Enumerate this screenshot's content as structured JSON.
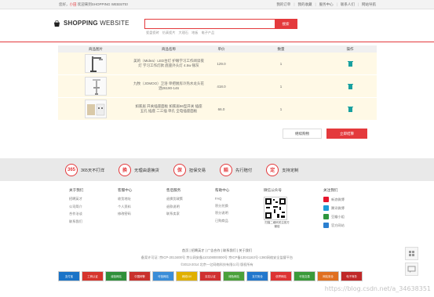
{
  "topbar": {
    "greeting": "您好，",
    "user": "小田",
    "welcome": "欢迎来到SHOPPING WEBSITE!",
    "links": [
      "我的订单",
      "我的收藏",
      "服务中心",
      "联系人们",
      "网站导航"
    ]
  },
  "logo": {
    "bold": "SHOPPING",
    "rest": " WEBSITE"
  },
  "search": {
    "placeholder": "",
    "button": "搜索",
    "hotwords": [
      "瓷盘瓷砖",
      "仿真瓷片",
      "大理石",
      "地板",
      "电子产品"
    ]
  },
  "cart": {
    "headers": [
      "商品图片",
      "商品名称",
      "单价",
      "数量",
      "操作"
    ],
    "rows": [
      {
        "name": "美的（Midea）LED台灯 护眼学习工作阅读夜灯 学习工作灯款 底座外头灯 4.5w 银灰",
        "price": "129.0",
        "qty": "1"
      },
      {
        "name": "九牧（JOMOO）卫浴 单把厨房冷热水龙头花洒26190-146",
        "price": "418.0",
        "qty": "1"
      },
      {
        "name": "如家居 开关插座面板 如家居86型开关 插座 五孔 插座 二三插 单孔 全电插座面板",
        "price": "66.0",
        "qty": "1"
      }
    ],
    "continue_button": "继续购物",
    "checkout_button": "立即结算"
  },
  "services": [
    {
      "icon": "365",
      "label": "365天不打烊"
    },
    {
      "icon": "换",
      "label": "无理由退换货"
    },
    {
      "icon": "保",
      "label": "担保交易"
    },
    {
      "icon": "赔",
      "label": "先行赔付"
    },
    {
      "icon": "定",
      "label": "支持定制"
    }
  ],
  "footer": {
    "columns": [
      {
        "title": "关于我们",
        "items": [
          "招聘英才",
          "公司简介",
          "合作洽谈",
          "联系我们"
        ]
      },
      {
        "title": "客服中心",
        "items": [
          "收货地址",
          "个人资料",
          "修改密码"
        ]
      },
      {
        "title": "售后服务",
        "items": [
          "退换货政策",
          "退款说明",
          "联系卖家"
        ]
      },
      {
        "title": "帮助中心",
        "items": [
          "FAQ",
          "积分兑换",
          "积分说明",
          "已购商品"
        ]
      }
    ],
    "qr_title": "微信公众号",
    "qr_caption": "扫描二维码关注官方微信",
    "follow_title": "关注我们",
    "follow_items": [
      "新浪微博",
      "腾讯微博",
      "豆瓣小组",
      "官方网站"
    ]
  },
  "bottom": {
    "links": [
      "首页",
      "招聘英才",
      "广告合作",
      "联系我们",
      "关于我们"
    ],
    "line2": "备案许可证: 京ICP-2013400号 京公网安备110108000000号 京ICP备13041163号-1360网络安全监督平台",
    "line3": "©2013-2014 北京一亿网络科技有限公司 版权所有"
  },
  "badges": [
    "支付宝",
    "工商认证",
    "诚信网站",
    "中国网警",
    "可信网站",
    "网络110",
    "实名认证",
    "绿色网站",
    "支付安全",
    "信誉网站",
    "可信交易",
    "网站安全",
    "电子商务"
  ],
  "side_buttons": [
    "回到顶部",
    "客服"
  ],
  "watermark": "https://blog.csdn.net/a_34638351"
}
